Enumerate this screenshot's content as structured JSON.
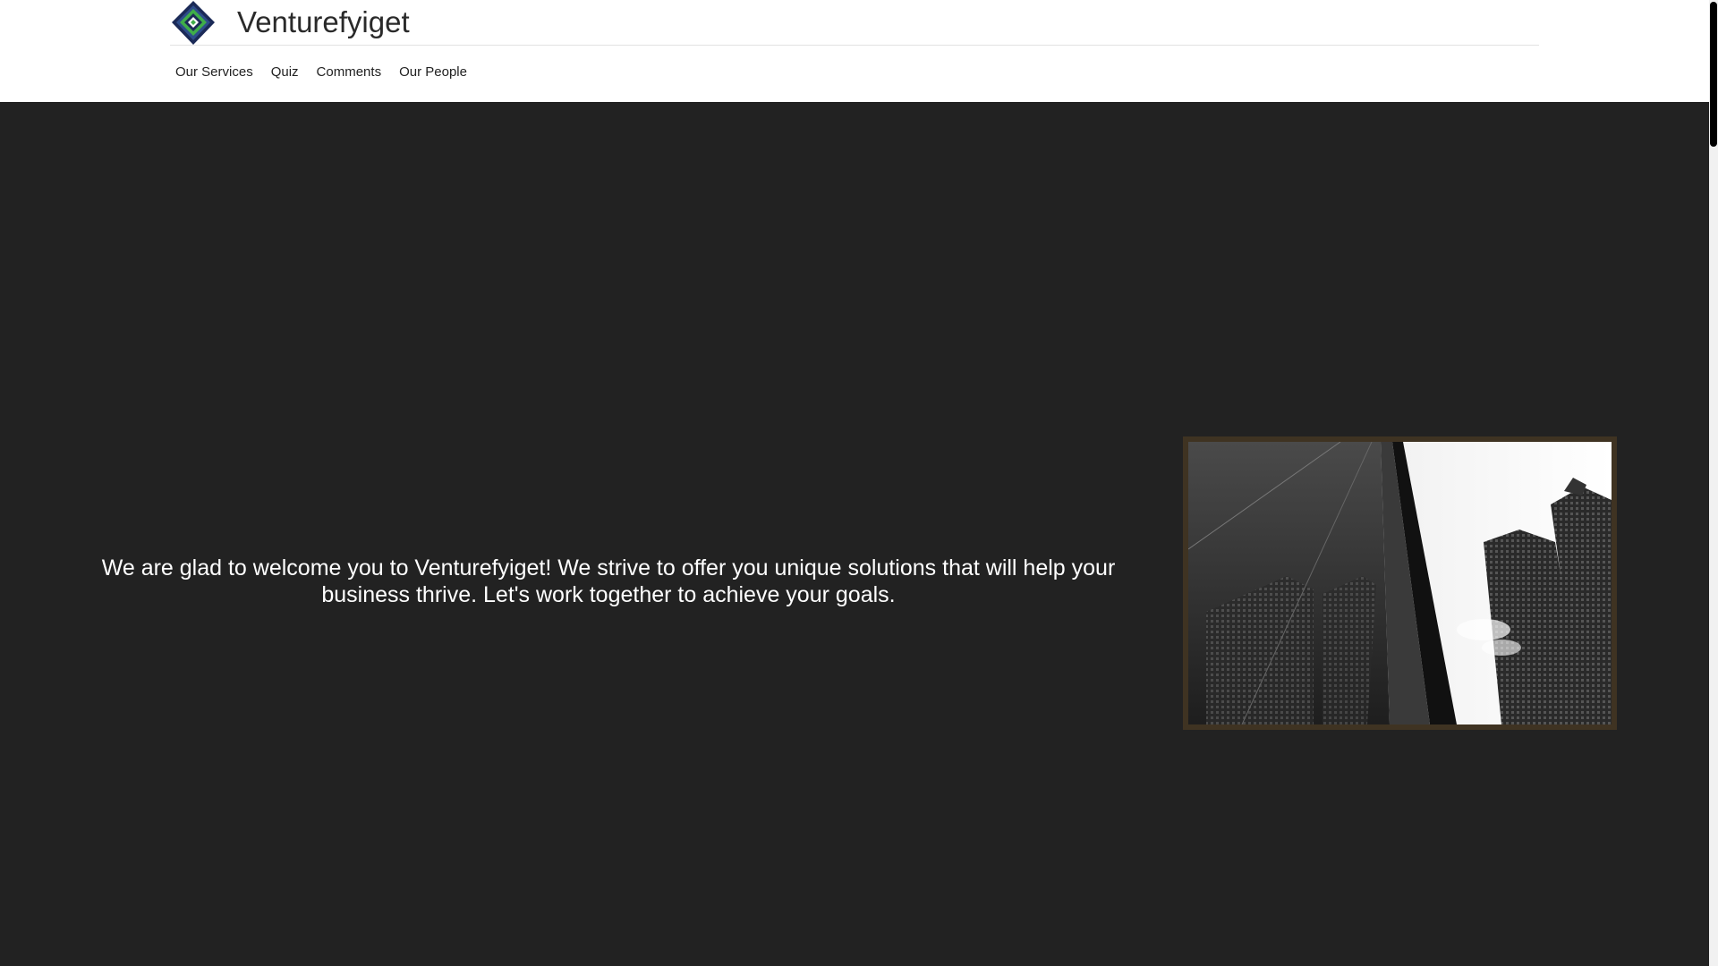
{
  "header": {
    "site_title": "Venturefyiget",
    "nav": [
      {
        "label": "Our Services"
      },
      {
        "label": "Quiz"
      },
      {
        "label": "Comments"
      },
      {
        "label": "Our People"
      }
    ]
  },
  "hero": {
    "text": "We are glad to welcome you to Venturefyiget! We strive to offer you unique solutions that will help your business thrive. Let's work together to achieve your goals."
  },
  "colors": {
    "hero_bg": "#222222",
    "frame": "#3f3322",
    "logo_dark": "#1b2a57",
    "logo_green": "#3fae49"
  }
}
